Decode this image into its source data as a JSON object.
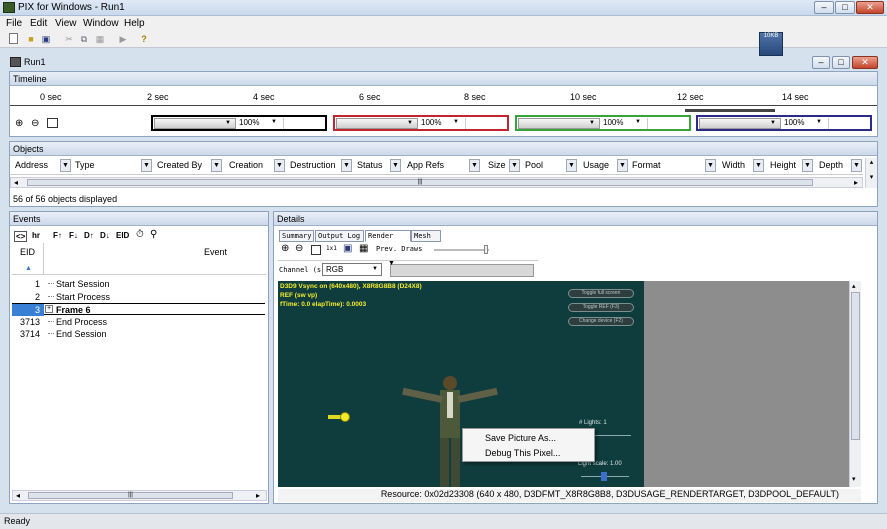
{
  "window": {
    "title": "PIX for Windows - Run1"
  },
  "menu": {
    "file": "File",
    "edit": "Edit",
    "view": "View",
    "window": "Window",
    "help": "Help"
  },
  "document": {
    "title": "Run1"
  },
  "thumbnail": {
    "label": "10KB"
  },
  "timeline": {
    "header": "Timeline",
    "ticks": [
      "0 sec",
      "2 sec",
      "4 sec",
      "6 sec",
      "8 sec",
      "10 sec",
      "12 sec",
      "14 sec"
    ],
    "zoom_values": [
      "100%",
      "100%",
      "100%",
      "100%"
    ],
    "segment_colors": [
      "#000000",
      "#c0262f",
      "#3aa23a",
      "#2a2a8a"
    ]
  },
  "objects": {
    "header": "Objects",
    "columns": [
      "Address",
      "Type",
      "Created By",
      "Creation",
      "Destruction",
      "Status",
      "App Refs",
      "Size",
      "Pool",
      "Usage",
      "Format",
      "Width",
      "Height",
      "Depth"
    ],
    "status_text": "56 of 56 objects displayed",
    "scroll_grip": "|||"
  },
  "events": {
    "header": "Events",
    "toolbar": [
      "<>",
      "hr",
      "F↑",
      "F↓",
      "D↑",
      "D↓",
      "EID"
    ],
    "col_eid": "EID",
    "col_event": "Event",
    "rows": [
      {
        "eid": "1",
        "event": "Start Session",
        "selected": false,
        "expander": ""
      },
      {
        "eid": "2",
        "event": "Start Process",
        "selected": false,
        "expander": ""
      },
      {
        "eid": "3",
        "event": "Frame 6",
        "selected": true,
        "expander": "+"
      },
      {
        "eid": "3713",
        "event": "End Process",
        "selected": false,
        "expander": ""
      },
      {
        "eid": "3714",
        "event": "End Session",
        "selected": false,
        "expander": ""
      }
    ]
  },
  "details": {
    "header": "Details",
    "tabs": [
      "Summary",
      "Output Log",
      "Render",
      "Mesh"
    ],
    "active_tab": "Render",
    "toolbar_labels": {
      "prev_draws": "Prev. Draws",
      "zoom_small": "1x1"
    },
    "channel_label": "Channel (s):",
    "channel_value": "RGB",
    "overlay_lines": [
      "D3D9 Vsync on (640x480), X8R8G8B8 (D24X8)",
      "REF (sw vp)",
      "fTime: 0.0  elapTime): 0.0003"
    ],
    "scene_buttons": [
      "Toggle full screen",
      "Toggle REF (F3)",
      "Change device (F2)"
    ],
    "lights_label": "# Lights: 1",
    "light_scale_label": "Light scale: 1.00",
    "context_menu": [
      "Save Picture As...",
      "Debug This Pixel..."
    ],
    "resource_status": "Resource: 0x02d23308 (640 x 480, D3DFMT_X8R8G8B8, D3DUSAGE_RENDERTARGET, D3DPOOL_DEFAULT)"
  },
  "statusbar": {
    "text": "Ready"
  }
}
